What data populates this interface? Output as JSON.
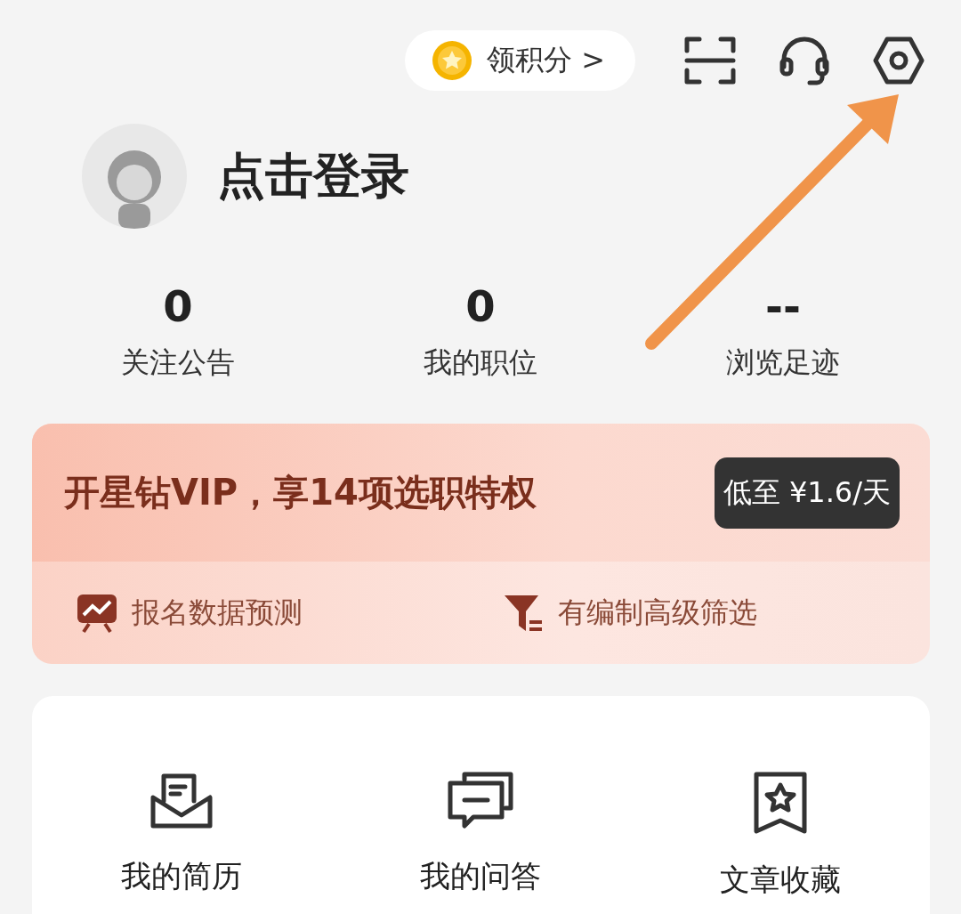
{
  "top_bar": {
    "points_button": {
      "label": "领积分 >"
    }
  },
  "profile": {
    "login_prompt": "点击登录"
  },
  "stats": [
    {
      "value": "0",
      "label": "关注公告"
    },
    {
      "value": "0",
      "label": "我的职位"
    },
    {
      "value": "--",
      "label": "浏览足迹"
    }
  ],
  "vip_banner": {
    "title": "开星钻VIP，享14项选职特权",
    "price_button": "低至 ¥1.6/天",
    "features": [
      {
        "kind": "chart",
        "label": "报名数据预测"
      },
      {
        "kind": "filter",
        "label": "有编制高级筛选"
      }
    ]
  },
  "shortcuts": [
    {
      "kind": "resume",
      "label": "我的简历"
    },
    {
      "kind": "qa",
      "label": "我的问答"
    },
    {
      "kind": "favorites",
      "label": "文章收藏"
    }
  ]
}
